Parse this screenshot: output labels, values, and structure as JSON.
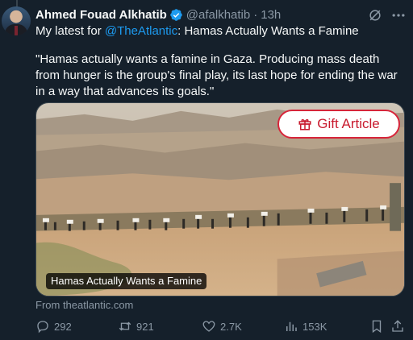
{
  "tweet": {
    "author_name": "Ahmed Fouad Alkhatib",
    "handle": "@afalkhatib",
    "separator": "·",
    "time": "13h",
    "text_prefix": "My latest for ",
    "mention": "@TheAtlantic",
    "text_suffix": ": Hamas Actually Wants a Famine",
    "quote": "\"Hamas actually wants a famine in Gaza. Producing mass death from hunger is the group's final play, its last hope for ending the war in a way that advances its goals.\""
  },
  "card": {
    "gift_label": "Gift Article",
    "title": "Hamas Actually Wants a Famine",
    "source": "From theatlantic.com"
  },
  "actions": {
    "replies": "292",
    "reposts": "921",
    "likes": "2.7K",
    "views": "153K"
  },
  "icons": [
    "verified-badge-icon",
    "grok-icon",
    "more-icon",
    "gift-icon",
    "reply-icon",
    "repost-icon",
    "like-icon",
    "views-icon",
    "bookmark-icon",
    "share-icon"
  ],
  "colors": {
    "background": "#15202b",
    "link": "#1d9bf0",
    "muted": "#8b98a5",
    "gift_red": "#c8192d"
  }
}
